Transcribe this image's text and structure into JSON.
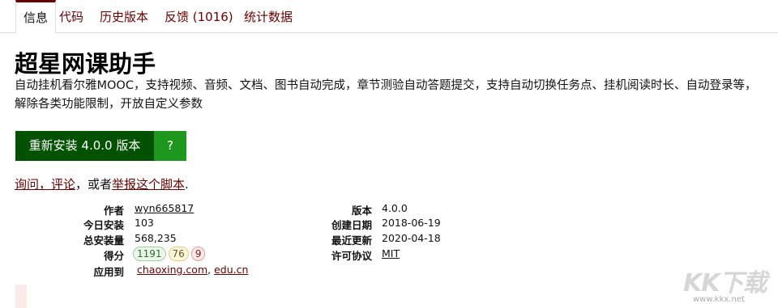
{
  "tabs": [
    {
      "label": "信息"
    },
    {
      "label": "代码"
    },
    {
      "label": "历史版本"
    },
    {
      "label": "反馈 (1016)"
    },
    {
      "label": "统计数据"
    }
  ],
  "script": {
    "title": "超星网课助手",
    "description": "自动挂机看尔雅MOOC，支持视频、音频、文档、图书自动完成，章节测验自动答题提交，支持自动切换任务点、挂机阅读时长、自动登录等，解除各类功能限制，开放自定义参数"
  },
  "install": {
    "button_label": "重新安装 4.0.0 版本",
    "help_label": "?"
  },
  "feedback": {
    "link1": "询问，评论",
    "middle": "，或者",
    "link2": "举报这个脚本",
    "end": "."
  },
  "meta": {
    "author_label": "作者",
    "author": "wyn665817",
    "daily_label": "今日安装",
    "daily": "103",
    "total_label": "总安装量",
    "total": "568,235",
    "score_label": "得分",
    "score_good": "1191",
    "score_ok": "76",
    "score_bad": "9",
    "applies_label": "应用到",
    "applies_1": "chaoxing.com",
    "applies_sep": ", ",
    "applies_2": "edu.cn",
    "version_label": "版本",
    "version": "4.0.0",
    "created_label": "创建日期",
    "created": "2018-06-19",
    "updated_label": "最近更新",
    "updated": "2020-04-18",
    "license_label": "许可协议",
    "license": "MIT"
  },
  "watermark": {
    "logo": "KK下载",
    "url": "www.kkx.net"
  }
}
